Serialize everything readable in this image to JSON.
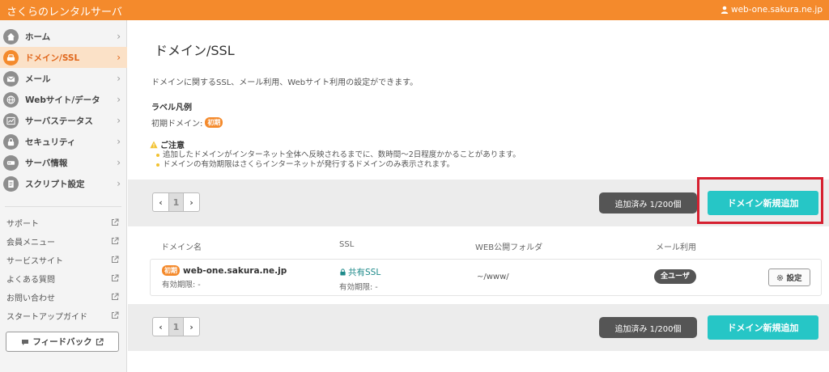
{
  "header": {
    "brand": "さくらのレンタルサーバ",
    "account": "web-one.sakura.ne.jp"
  },
  "sidebar": {
    "items": [
      {
        "label": "ホーム",
        "icon": "home-icon"
      },
      {
        "label": "ドメイン/SSL",
        "icon": "domain-icon",
        "active": true
      },
      {
        "label": "メール",
        "icon": "mail-icon"
      },
      {
        "label": "Webサイト/データ",
        "icon": "globe-icon"
      },
      {
        "label": "サーバステータス",
        "icon": "chart-icon"
      },
      {
        "label": "セキュリティ",
        "icon": "lock-icon"
      },
      {
        "label": "サーバ情報",
        "icon": "server-icon"
      },
      {
        "label": "スクリプト設定",
        "icon": "script-icon"
      }
    ],
    "links": [
      {
        "label": "サポート"
      },
      {
        "label": "会員メニュー"
      },
      {
        "label": "サービスサイト"
      },
      {
        "label": "よくある質問"
      },
      {
        "label": "お問い合わせ"
      },
      {
        "label": "スタートアップガイド"
      }
    ],
    "feedback_label": "フィードバック"
  },
  "main": {
    "title": "ドメイン/SSL",
    "description": "ドメインに関するSSL、メール利用、Webサイト利用の設定ができます。",
    "legend": {
      "title": "ラベル凡例",
      "label": "初期ドメイン:",
      "badge": "初期"
    },
    "notice": {
      "title": "ご注意",
      "items": [
        "追加したドメインがインターネット全体へ反映されるまでに、数時間〜2日程度かかることがあります。",
        "ドメインの有効期限はさくらインターネットが発行するドメインのみ表示されます。"
      ]
    },
    "pager": {
      "prev": "‹",
      "page": "1",
      "next": "›"
    },
    "count": "追加済み 1/200個",
    "add_button": "ドメイン新規追加",
    "table": {
      "headers": [
        "ドメイン名",
        "SSL",
        "WEB公開フォルダ",
        "メール利用"
      ],
      "rows": [
        {
          "badge": "初期",
          "domain": "web-one.sakura.ne.jp",
          "domain_expiry": "有効期限: -",
          "ssl": "共有SSL",
          "ssl_expiry": "有効期限: -",
          "folder": "~/www/",
          "mail": "全ユーザ",
          "setting": "設定"
        }
      ]
    }
  },
  "colors": {
    "accent": "#f48a2c",
    "teal": "#26c6c6",
    "highlight": "#d62030"
  }
}
